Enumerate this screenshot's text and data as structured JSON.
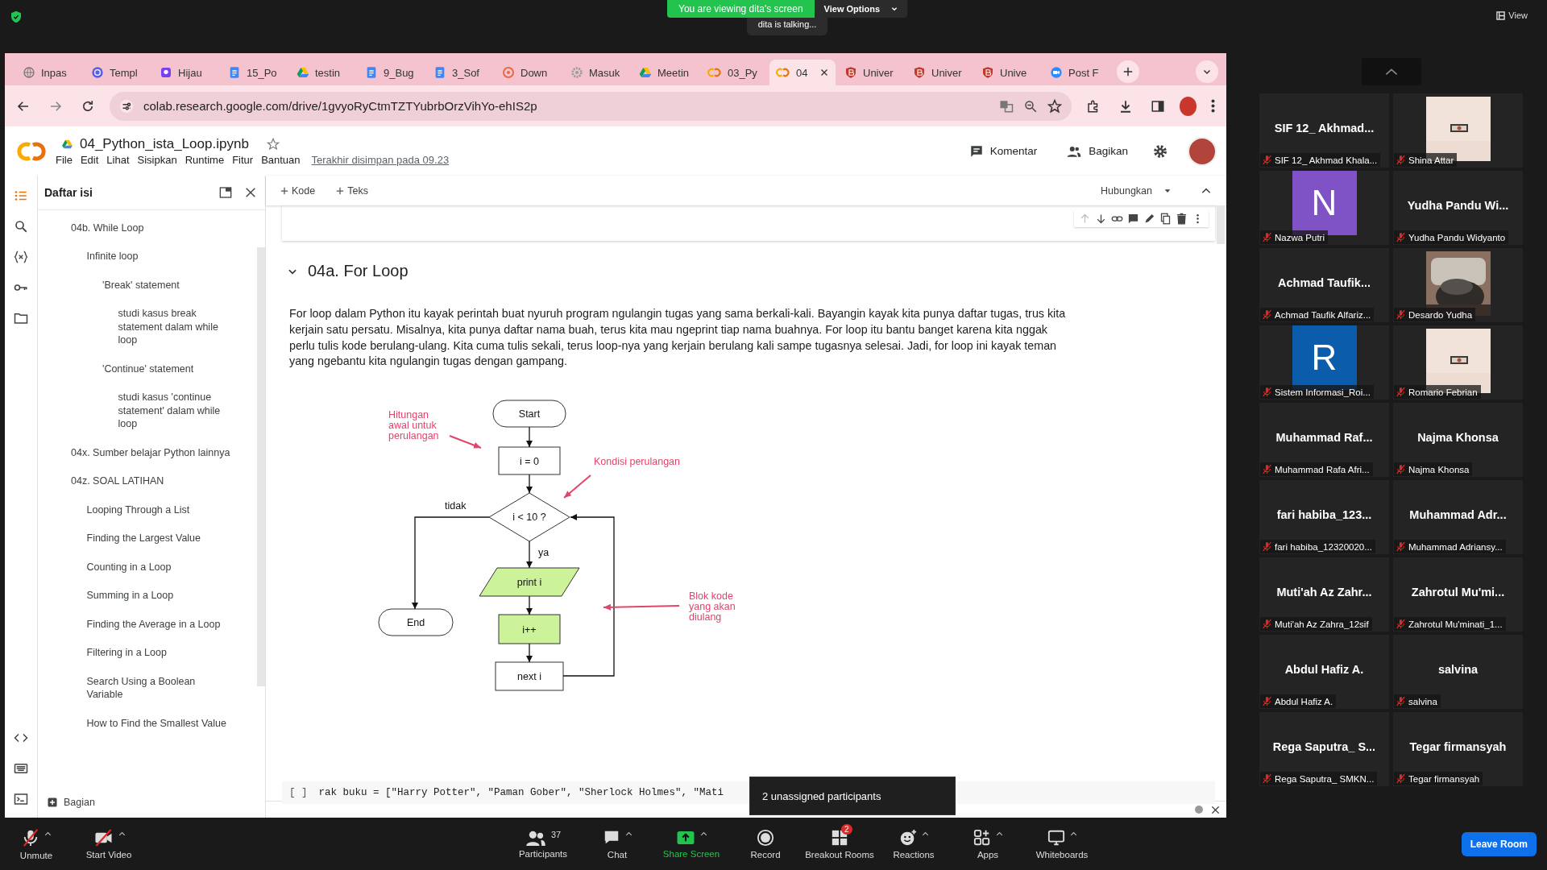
{
  "zoom": {
    "banner": "You are viewing dita's screen",
    "view_options": "View Options",
    "speaker": "dita is talking...",
    "view_label": "View"
  },
  "browser": {
    "tabs": [
      {
        "label": "Inpas",
        "kind": "globe",
        "selected": false
      },
      {
        "label": "Templ",
        "kind": "canva",
        "selected": false
      },
      {
        "label": "Hijau",
        "kind": "badge",
        "selected": false
      },
      {
        "label": "15_Po",
        "kind": "docs",
        "selected": false
      },
      {
        "label": "testin",
        "kind": "drive",
        "selected": false
      },
      {
        "label": "9_Bug",
        "kind": "docs",
        "selected": false
      },
      {
        "label": "3_Sof",
        "kind": "docs",
        "selected": false
      },
      {
        "label": "Down",
        "kind": "ring",
        "selected": false
      },
      {
        "label": "Masuk",
        "kind": "gear",
        "selected": false
      },
      {
        "label": "Meetin",
        "kind": "drive",
        "selected": false
      },
      {
        "label": "03_Py",
        "kind": "colab",
        "selected": false
      },
      {
        "label": "04",
        "kind": "colab",
        "selected": true
      },
      {
        "label": "Univer",
        "kind": "shield",
        "selected": false
      },
      {
        "label": "Univer",
        "kind": "shield",
        "selected": false
      },
      {
        "label": "Unive",
        "kind": "shield",
        "selected": false
      },
      {
        "label": "Post F",
        "kind": "zoom",
        "selected": false
      }
    ],
    "url": "colab.research.google.com/drive/1gvyoRyCtmTZTYubrbOrzVihYo-ehIS2p"
  },
  "colab": {
    "title": "04_Python_ista_Loop.ipynb",
    "menu": [
      "File",
      "Edit",
      "Lihat",
      "Sisipkan",
      "Runtime",
      "Fitur",
      "Bantuan"
    ],
    "saved": "Terakhir disimpan pada 09.23",
    "comment": "Komentar",
    "share": "Bagikan",
    "add_code": "Kode",
    "add_text": "Teks",
    "connect": "Hubungkan",
    "toc": {
      "title": "Daftar isi",
      "add_section": "Bagian",
      "items": [
        {
          "label": "04b. While Loop",
          "children": [
            {
              "label": "Infinite loop",
              "children": [
                {
                  "label": "'Break' statement",
                  "children": [
                    {
                      "label": "studi kasus break statement dalam while loop"
                    }
                  ]
                },
                {
                  "label": "'Continue' statement",
                  "children": [
                    {
                      "label": "studi kasus 'continue statement' dalam while loop"
                    }
                  ]
                }
              ]
            }
          ]
        },
        {
          "label": "04x. Sumber belajar Python lainnya"
        },
        {
          "label": "04z. SOAL LATIHAN",
          "children": [
            {
              "label": "Looping Through a List"
            },
            {
              "label": "Finding the Largest Value"
            },
            {
              "label": "Counting in a Loop"
            },
            {
              "label": "Summing in a Loop"
            },
            {
              "label": "Finding the Average in a Loop"
            },
            {
              "label": "Filtering in a Loop"
            },
            {
              "label": "Search Using a Boolean Variable"
            },
            {
              "label": "How to Find the Smallest Value"
            }
          ]
        }
      ]
    },
    "section": {
      "title": "04a. For Loop",
      "expanded": true
    },
    "paragraph": "For loop dalam Python itu kayak perintah buat nyuruh program ngulangin tugas yang sama berkali-kali. Bayangin kayak kita punya daftar tugas, trus kita kerjain satu persatu. Misalnya, kita punya daftar nama buah, terus kita mau ngeprint tiap nama buahnya. For loop itu bantu banget karena kita nggak perlu tulis kode berulang-ulang. Kita cuma tulis sekali, terus loop-nya yang kerjain berulang kali sampe tugasnya selesai. Jadi, for loop ini kayak teman yang ngebantu kita ngulangin tugas dengan gampang.",
    "flowchart": {
      "start": "Start",
      "init": "i = 0",
      "condition": "i < 10 ?",
      "no": "tidak",
      "yes": "ya",
      "body": "print i",
      "increment": "i++",
      "next": "next i",
      "end": "End",
      "note_init": "Hitungan\nawal untuk\nperulangan",
      "note_condition": "Kondisi perulangan",
      "note_body": "Blok kode\nyang akan\ndiulang"
    },
    "code": {
      "run": "[ ]",
      "text": "rak buku = [\"Harry Potter\", \"Paman Gober\", \"Sherlock Holmes\", \"Mati"
    }
  },
  "participants": [
    {
      "kind": "name",
      "title": "SIF 12_ Akhmad...",
      "name": "SIF 12_ Akhmad Khala...",
      "muted": true
    },
    {
      "name": "Shina Attar",
      "muted": true
    },
    {
      "kind": "avatar",
      "letter": "N",
      "color": "#7f52c5",
      "name": "Nazwa Putri",
      "muted": true
    },
    {
      "kind": "name",
      "title": "Yudha Pandu Wi...",
      "name": "Yudha Pandu Widyanto",
      "muted": true
    },
    {
      "kind": "name",
      "title": "Achmad Taufik...",
      "name": "Achmad Taufik Alfariz...",
      "muted": true
    },
    {
      "name": "Desardo Yudha",
      "muted": true
    },
    {
      "kind": "avatar",
      "letter": "R",
      "color": "#0b5cab",
      "name": "Sistem Informasi_Roi...",
      "muted": true
    },
    {
      "name": "Romario Febrian",
      "muted": true
    },
    {
      "kind": "name",
      "title": "Muhammad Raf...",
      "name": "Muhammad Rafa Afri...",
      "muted": true
    },
    {
      "kind": "name",
      "title": "Najma Khonsa",
      "name": "Najma Khonsa",
      "muted": true
    },
    {
      "kind": "name",
      "title": "fari habiba_123...",
      "name": "fari habiba_12320020...",
      "muted": true
    },
    {
      "kind": "name",
      "title": "Muhammad Adr...",
      "name": "Muhammad Adriansy...",
      "muted": true
    },
    {
      "kind": "name",
      "title": "Muti'ah Az Zahr...",
      "name": "Muti'ah Az Zahra_12sif",
      "muted": true
    },
    {
      "kind": "name",
      "title": "Zahrotul Mu'mi...",
      "name": "Zahrotul Mu'minati_1...",
      "muted": true
    },
    {
      "kind": "name",
      "title": "Abdul Hafiz A.",
      "name": "Abdul Hafiz A.",
      "muted": true
    },
    {
      "kind": "name",
      "title": "salvina",
      "name": "salvina",
      "muted": true
    },
    {
      "kind": "name",
      "title": "Rega Saputra_ S...",
      "name": "Rega Saputra_ SMKN...",
      "muted": true
    },
    {
      "kind": "name",
      "title": "Tegar firmansyah",
      "name": "Tegar firmansyah",
      "muted": true
    }
  ],
  "toolbar": {
    "audio": {
      "label": "Unmute",
      "muted": true,
      "caret": true
    },
    "video": {
      "label": "Start Video",
      "on": false,
      "caret": true
    },
    "items": [
      {
        "kind": "participants",
        "label": "Participants",
        "count": "37",
        "caret": false
      },
      {
        "kind": "chat",
        "label": "Chat",
        "caret": true
      },
      {
        "kind": "share",
        "label": "Share Screen",
        "caret": true
      },
      {
        "kind": "record",
        "label": "Record",
        "caret": false
      },
      {
        "kind": "breakout",
        "label": "Breakout Rooms",
        "badge": "2",
        "caret": false
      },
      {
        "kind": "reactions",
        "label": "Reactions",
        "caret": true
      },
      {
        "kind": "apps",
        "label": "Apps",
        "caret": true
      },
      {
        "kind": "whiteboards",
        "label": "Whiteboards",
        "caret": true
      }
    ],
    "leave": "Leave Room",
    "tooltip": "2 unassigned participants"
  }
}
